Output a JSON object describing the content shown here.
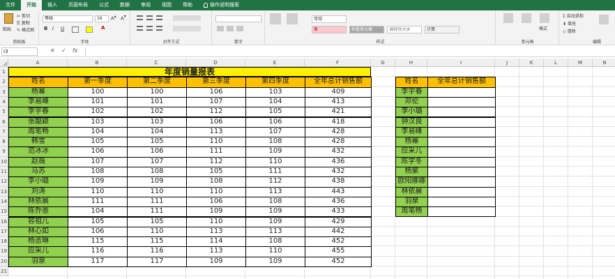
{
  "tabs": [
    "文件",
    "开始",
    "插入",
    "页面布局",
    "公式",
    "数据",
    "审阅",
    "视图",
    "帮助",
    "操作说明搜索"
  ],
  "ribbon": {
    "clipboard": {
      "cut": "剪切",
      "copy": "复制",
      "format_painter": "格式刷",
      "paste": "粘贴",
      "label": "剪贴板"
    },
    "font": {
      "name": "等线",
      "size": "16",
      "bold": "B",
      "italic": "I",
      "underline": "U",
      "label": "字体"
    },
    "align": {
      "label": "对齐方式"
    },
    "number": {
      "label": "数字"
    },
    "styles": {
      "normal": "常规",
      "bad": "差",
      "check_cell": "检查单元格",
      "calc": "计算",
      "explanatory": "解释性文本",
      "label": "样式"
    },
    "cells": {
      "format": "格式",
      "label": "单元格"
    },
    "editing": {
      "autosum": "自动求和",
      "fill": "填充",
      "clear": "清除",
      "label": "编辑"
    }
  },
  "formula_bar": {
    "name_box": "I3",
    "cancel": "✕",
    "enter": "✓",
    "fx": "fx",
    "value": ""
  },
  "columns": [
    "A",
    "B",
    "C",
    "D",
    "E",
    "F",
    "G",
    "H",
    "I",
    "J",
    "K",
    "L",
    "M",
    "N"
  ],
  "rows": [
    "1",
    "2",
    "3",
    "4",
    "5",
    "6",
    "7",
    "8",
    "9",
    "10",
    "11",
    "12",
    "13",
    "14",
    "15",
    "16",
    "17",
    "18",
    "19",
    "20",
    "21"
  ],
  "sheet": {
    "title": "年度销量报表",
    "headers": [
      "姓名",
      "第一季度",
      "第二季度",
      "第三季度",
      "第四季度",
      "全年总计销售额"
    ],
    "data": [
      [
        "杨幂",
        "100",
        "100",
        "106",
        "103",
        "409"
      ],
      [
        "李易峰",
        "101",
        "101",
        "107",
        "104",
        "413"
      ],
      [
        "李宇春",
        "102",
        "102",
        "112",
        "105",
        "421"
      ],
      [
        "张靓颖",
        "103",
        "103",
        "106",
        "106",
        "418"
      ],
      [
        "周笔畅",
        "104",
        "104",
        "113",
        "107",
        "428"
      ],
      [
        "韩雪",
        "105",
        "105",
        "110",
        "108",
        "428"
      ],
      [
        "范冰冰",
        "106",
        "106",
        "111",
        "109",
        "432"
      ],
      [
        "赵薇",
        "107",
        "107",
        "112",
        "110",
        "436"
      ],
      [
        "马苏",
        "108",
        "108",
        "105",
        "111",
        "432"
      ],
      [
        "李小璐",
        "109",
        "109",
        "108",
        "112",
        "438"
      ],
      [
        "刘涛",
        "110",
        "110",
        "110",
        "113",
        "443"
      ],
      [
        "林依晨",
        "111",
        "111",
        "106",
        "108",
        "436"
      ],
      [
        "陈乔恩",
        "104",
        "111",
        "109",
        "109",
        "433"
      ],
      [
        "容祖儿",
        "105",
        "105",
        "110",
        "109",
        "429"
      ],
      [
        "林心如",
        "106",
        "110",
        "113",
        "113",
        "442"
      ],
      [
        "杨丞琳",
        "115",
        "115",
        "114",
        "108",
        "452"
      ],
      [
        "应采儿",
        "116",
        "116",
        "113",
        "110",
        "455"
      ],
      [
        "羽泉",
        "117",
        "117",
        "109",
        "109",
        "452"
      ]
    ],
    "data_fix": {
      "row17_col4": "109",
      "row17_total": "452"
    },
    "lookup_headers": [
      "姓名",
      "全年总计销售额"
    ],
    "lookup_names": [
      "李宇春",
      "邓伦",
      "李小璐",
      "钟汉良",
      "李易峰",
      "杨幂",
      "应采儿",
      "陈学冬",
      "杨紫",
      "欧阳娜娜",
      "林依晨",
      "羽泉",
      "周笔畅"
    ]
  },
  "colors": {
    "title_bg": "#fff000",
    "header_bg": "#ffc000",
    "name_bg": "#92d050",
    "ribbon_green": "#217346"
  }
}
